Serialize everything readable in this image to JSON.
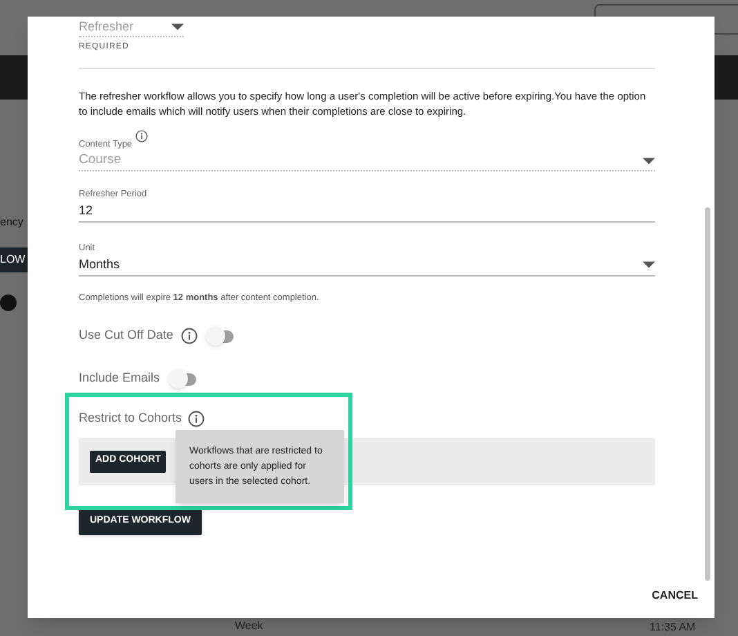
{
  "background": {
    "side_label": "ency",
    "side_button": "LOW",
    "footer_texts": [
      "Week",
      "11:35 AM"
    ]
  },
  "dialog": {
    "workflow_type": {
      "value": "Refresher",
      "disabled": true,
      "hint": "REQUIRED"
    },
    "description": "The refresher workflow allows you to specify how long a user's completion will be active before expiring.You have the option to include emails which will notify users when their completions are close to expiring.",
    "content_type": {
      "label": "Content Type",
      "value": "Course",
      "disabled": true
    },
    "refresher_period": {
      "label": "Refresher Period",
      "value": "12"
    },
    "unit": {
      "label": "Unit",
      "value": "Months"
    },
    "expiry_note": "Completions will expire **12 months** after content completion.",
    "toggles": [
      {
        "label": "Use Cut Off Date",
        "info": true,
        "on": false
      },
      {
        "label": "Include Emails",
        "info": false,
        "on": false
      }
    ],
    "cohorts": {
      "label": "Restrict to Cohorts",
      "button": "ADD COHORT",
      "highlighted": true,
      "tooltip": "Workflows that are restricted to cohorts are only applied for users in the selected cohort."
    },
    "update_button": "UPDATE WORKFLOW",
    "cancel_button": "CANCEL"
  }
}
